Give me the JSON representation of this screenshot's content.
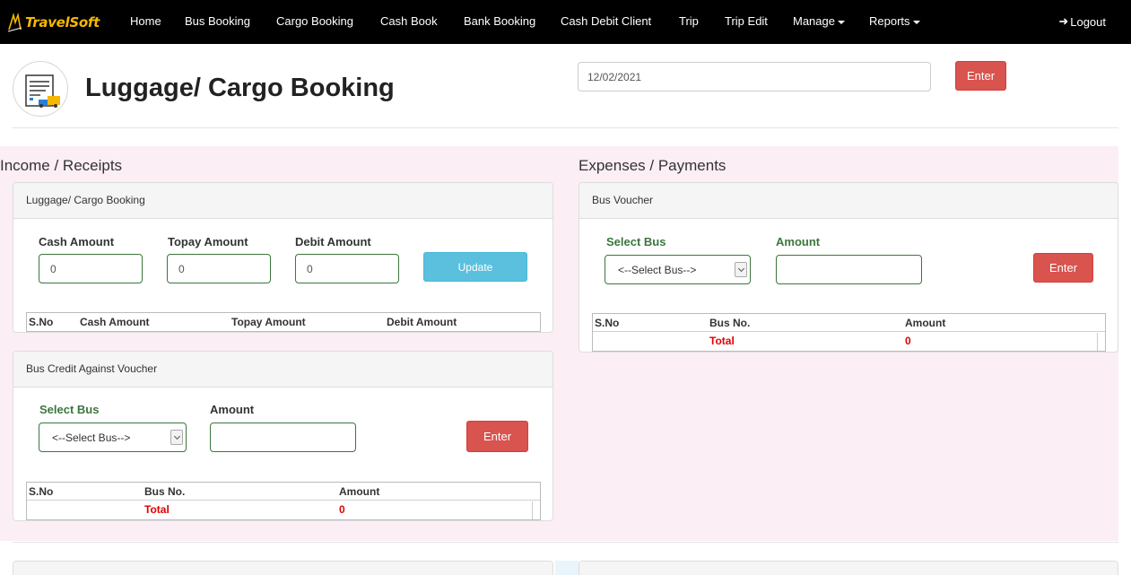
{
  "brand": {
    "logo_text": "TravelSoft"
  },
  "nav": {
    "home": "Home",
    "bus_booking": "Bus Booking",
    "cargo_booking": "Cargo Booking",
    "cash_book": "Cash Book",
    "bank_booking": "Bank Booking",
    "cash_debit_client": "Cash Debit Client",
    "trip": "Trip",
    "trip_edit": "Trip Edit",
    "manage": "Manage",
    "reports": "Reports",
    "logout": "Logout"
  },
  "header": {
    "title": "Luggage/ Cargo Booking",
    "date_value": "12/02/2021",
    "enter_label": "Enter"
  },
  "income": {
    "section_title": "Income / Receipts",
    "luggage_panel": {
      "heading": "Luggage/ Cargo Booking",
      "cash_amount_label": "Cash Amount",
      "topay_amount_label": "Topay Amount",
      "debit_amount_label": "Debit Amount",
      "cash_amount_value": "0",
      "topay_amount_value": "0",
      "debit_amount_value": "0",
      "update_label": "Update",
      "table_headers": [
        "S.No",
        "Cash Amount",
        "Topay Amount",
        "Debit Amount"
      ]
    },
    "bus_credit_panel": {
      "heading": "Bus Credit Against Voucher",
      "select_bus_label": "Select Bus",
      "amount_label": "Amount",
      "select_value": "<--Select Bus-->",
      "amount_value": "",
      "enter_label": "Enter",
      "table_headers": [
        "S.No",
        "Bus No.",
        "Amount"
      ],
      "total_label": "Total",
      "total_value": "0"
    }
  },
  "expenses": {
    "section_title": "Expenses / Payments",
    "bus_voucher_panel": {
      "heading": "Bus Voucher",
      "select_bus_label": "Select Bus",
      "amount_label": "Amount",
      "select_value": "<--Select Bus-->",
      "amount_value": "",
      "enter_label": "Enter",
      "table_headers": [
        "S.No",
        "Bus No.",
        "Amount"
      ],
      "total_label": "Total",
      "total_value": "0"
    }
  },
  "colors": {
    "navbar_bg": "#000000",
    "brand_yellow": "#f5b800",
    "danger_red": "#d9534f",
    "info_blue": "#5bc0de",
    "success_green": "#3c763d",
    "total_red": "#e00000",
    "pink_bg": "#fbeef4"
  },
  "icons": {
    "logo": "bus-logo-icon",
    "logout": "sign-in-icon",
    "page": "cargo-document-truck-icon"
  }
}
